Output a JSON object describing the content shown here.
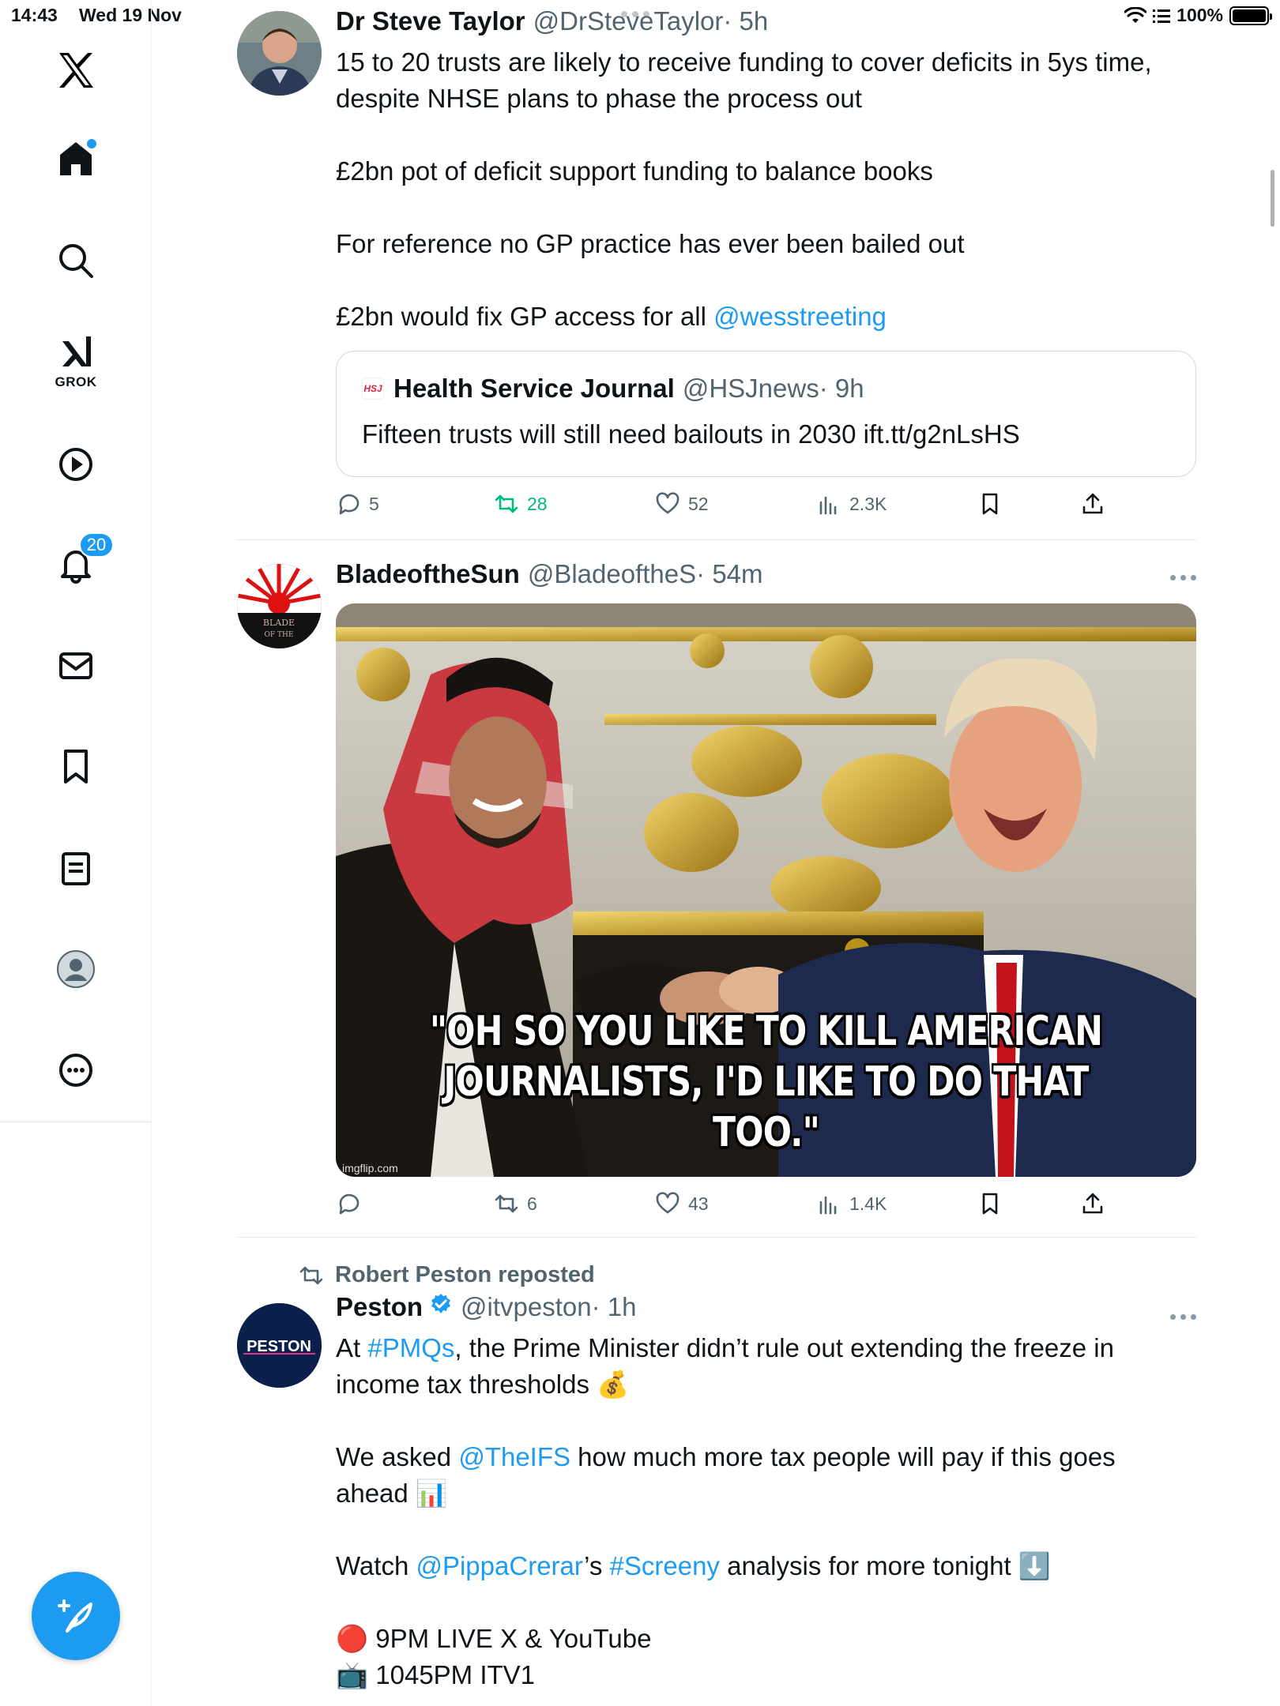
{
  "status_bar": {
    "time": "14:43",
    "date": "Wed 19 Nov",
    "battery": "100%"
  },
  "sidebar": {
    "logo_icon": "x-logo-icon",
    "items": [
      {
        "name": "home",
        "icon": "home-icon"
      },
      {
        "name": "explore",
        "icon": "search-icon"
      },
      {
        "name": "grok",
        "icon": "grok-icon",
        "label": "GROK"
      },
      {
        "name": "video",
        "icon": "play-icon"
      },
      {
        "name": "notifications",
        "icon": "bell-icon",
        "badge": "20"
      },
      {
        "name": "messages",
        "icon": "mail-icon"
      },
      {
        "name": "bookmarks",
        "icon": "bookmark-icon"
      },
      {
        "name": "lists",
        "icon": "list-icon"
      },
      {
        "name": "profile",
        "icon": "avatar-icon"
      },
      {
        "name": "more",
        "icon": "more-icon"
      }
    ],
    "compose_icon": "compose-feather-icon"
  },
  "posts": [
    {
      "name": "Dr Steve Taylor",
      "handle": "@DrSteveTaylor",
      "time": "· 5h",
      "lines": [
        "15 to 20 trusts are likely to receive funding to cover deficits in 5ys time,",
        "despite NHSE plans to phase the process out",
        "£2bn pot of deficit support funding to balance books",
        "For reference no GP practice has ever been bailed out",
        "£2bn would fix GP access for all ",
        "@wesstreeting"
      ],
      "quote": {
        "logo": "HSJ",
        "name": "Health Service Journal",
        "handle": "@HSJnews",
        "time": "· 9h",
        "text": "Fifteen trusts will still need bailouts in 2030 ift.tt/g2nLsHS"
      },
      "stats": {
        "replies": "5",
        "reposts": "28",
        "likes": "52",
        "views": "2.3K"
      }
    },
    {
      "name": "BladeoftheSun",
      "handle": "@BladeoftheS",
      "time": "· 54m",
      "avatar_text": "BLADE OF THE",
      "media": {
        "caption_line1": "\"OH SO YOU LIKE TO KILL AMERICAN",
        "caption_line2": "JOURNALISTS, I'D LIKE TO DO THAT TOO.\"",
        "watermark": "imgflip.com"
      },
      "stats": {
        "replies": "",
        "reposts": "6",
        "likes": "43",
        "views": "1.4K"
      }
    },
    {
      "reposted_by": "Robert Peston reposted",
      "name": "Peston",
      "handle": "@itvpeston",
      "time": "· 1h",
      "avatar_text": "PESTON",
      "segments": {
        "l1_a": "At ",
        "l1_tag": "#PMQs",
        "l1_b": ", the Prime Minister didn’t rule out extending the freeze in",
        "l2": "income tax thresholds 💰",
        "l3_a": "We asked ",
        "l3_tag": "@TheIFS",
        "l3_b": " how much more tax people will pay if this goes",
        "l4": "ahead 📊",
        "l5_a": "Watch ",
        "l5_tag": "@PippaCrerar",
        "l5_b": "’s ",
        "l5_tag2": "#Screeny",
        "l5_c": " analysis for more tonight ⬇️",
        "l6": "🔴 9PM LIVE X & YouTube",
        "l7": "📺 1045PM ITV1"
      }
    }
  ]
}
